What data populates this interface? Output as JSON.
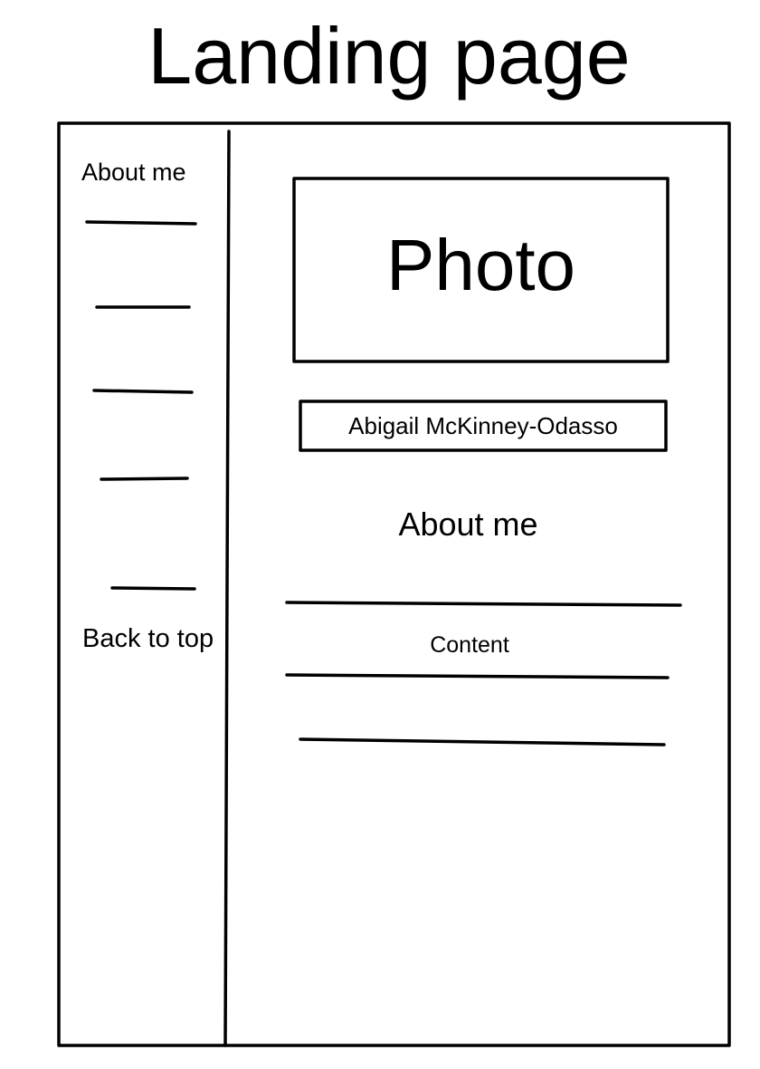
{
  "title": "Landing page",
  "sidebar": {
    "heading": "About me",
    "back_to_top": "Back to top"
  },
  "main": {
    "photo_label": "Photo",
    "name": "Abigail McKinney-Odasso",
    "about_heading": "About me",
    "content_label": "Content"
  }
}
